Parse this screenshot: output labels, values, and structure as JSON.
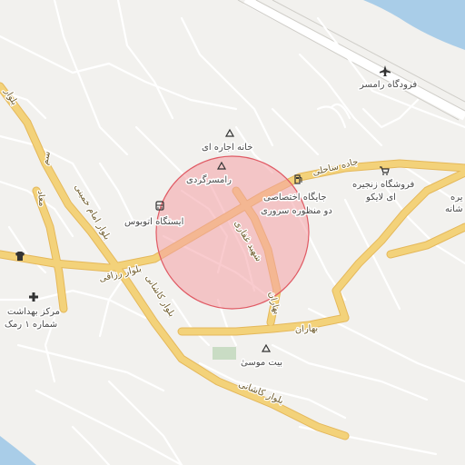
{
  "map": {
    "colors": {
      "land": "#f2f1ee",
      "water": "#a9cde8",
      "major_road": "#f3d27a",
      "major_road_casing": "#e5b85a",
      "minor_road": "#ffffff",
      "minor_road_casing": "#d6d4cf",
      "highlight_fill": "#f4a0a5",
      "highlight_stroke": "#e05a64",
      "park": "#c9dcc4",
      "poi": "#333333"
    },
    "roads": {
      "jadeh_saheli": "جاده ساحلی",
      "bolvar_razaqi": "بلوار رزاقی",
      "bolvar_kashani_1": "بلوار کاشانی",
      "bolvar_kashani_2": "بلوار کاشانی",
      "bolvar_emam_khomeini": "بلوار امام خمینی",
      "shahid_ghaffari": "شهید غفاری",
      "bahaaran_1": "بهاران",
      "bahaaran_2": "بهاران",
      "bolvar_left": "بلوار",
      "sam": "سم",
      "maad": "معاد"
    },
    "pois": {
      "airport": "فرودگاه رامسر",
      "khaneh_ejareh": "خانه اجاره ای",
      "ramsargardi": "رامسرگردی",
      "bus_station": "ایستگاه اتوبوس",
      "gas_station_1": "جایگاه اختصاصی",
      "gas_station_2": "دو منظوره سروری",
      "store_1": "فروشگاه زنجیره",
      "store_2": "ای لایکو",
      "store_edge_1": "یره",
      "store_edge_2": "شانه",
      "health_1": "مرکز بهداشت",
      "health_2": "شماره ۱ رمک",
      "beit_mousi": "بیت موسیٰ"
    },
    "icons": {
      "airport": "airplane-icon",
      "landmark": "triangle-icon",
      "bus": "bus-icon",
      "fuel": "fuel-icon",
      "shop": "shopping-cart-icon",
      "health": "cross-icon",
      "clothing": "shirt-icon"
    }
  }
}
